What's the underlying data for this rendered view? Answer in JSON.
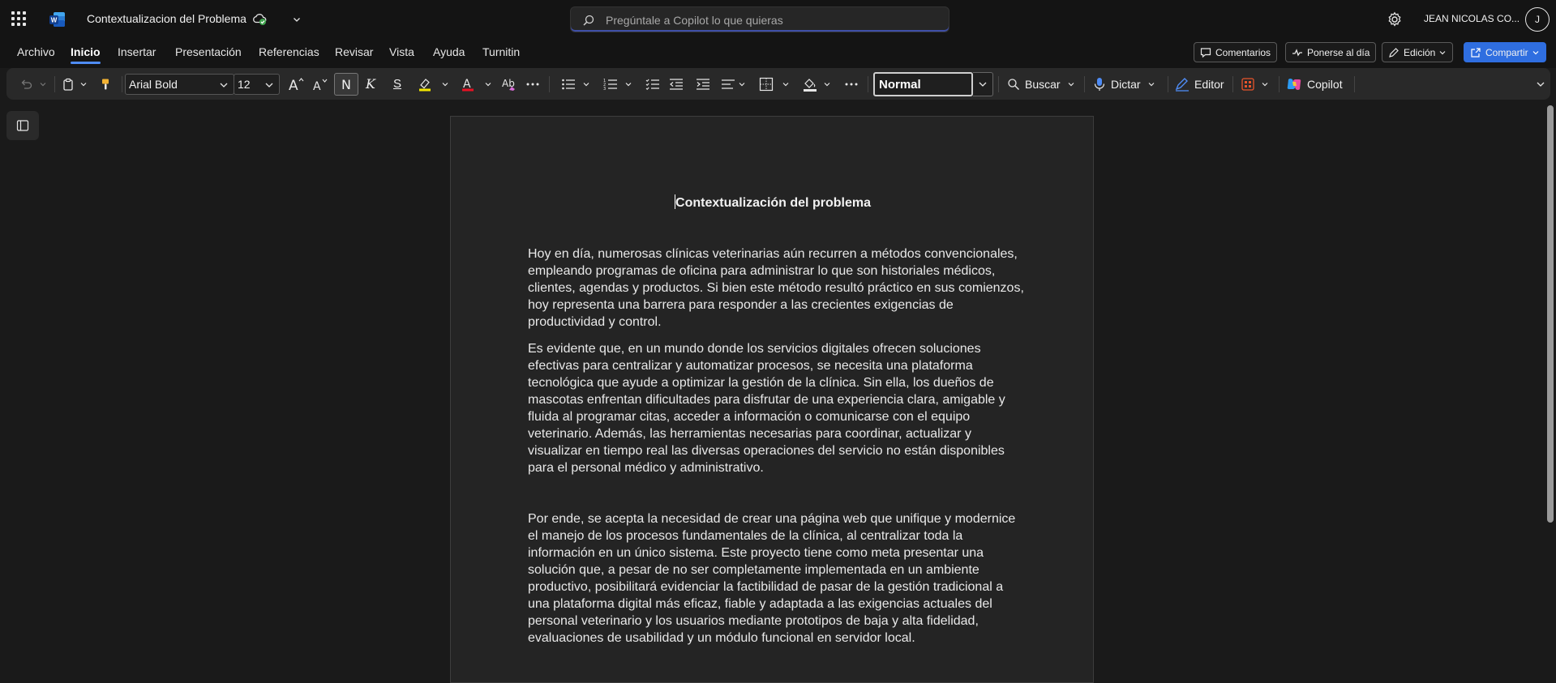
{
  "app": {
    "document_title": "Contextualizacion del Problema",
    "search_placeholder": "Pregúntale a Copilot lo que quieras",
    "user_name": "JEAN NICOLAS CO...",
    "avatar_initial": "J",
    "accent_color": "#2f6ee0",
    "word_blue": "#185abd"
  },
  "ribbon": {
    "tabs": [
      {
        "label": "Archivo",
        "active": false
      },
      {
        "label": "Inicio",
        "active": true
      },
      {
        "label": "Insertar",
        "active": false
      },
      {
        "label": "Presentación",
        "active": false
      },
      {
        "label": "Referencias",
        "active": false
      },
      {
        "label": "Revisar",
        "active": false
      },
      {
        "label": "Vista",
        "active": false
      },
      {
        "label": "Ayuda",
        "active": false
      },
      {
        "label": "Turnitin",
        "active": false
      }
    ],
    "buttons": {
      "comments": "Comentarios",
      "catch_up": "Ponerse al día",
      "editing": "Edición",
      "share": "Compartir"
    }
  },
  "toolbar": {
    "font_name": "Arial Bold",
    "font_size": "12",
    "bold_glyph": "N",
    "italic_glyph": "K",
    "underline_glyph": "S",
    "style_name": "Normal",
    "find_label": "Buscar",
    "dictate_label": "Dictar",
    "editor_label": "Editor",
    "copilot_label": "Copilot"
  },
  "document": {
    "heading": "Contextualización del problema",
    "paragraphs": [
      "Hoy en día, numerosas clínicas veterinarias aún recurren a métodos convencionales, empleando programas de oficina para administrar lo que son historiales médicos, clientes, agendas y productos. Si bien este método resultó práctico en sus comienzos, hoy representa una barrera para responder a las crecientes exigencias de productividad y control.",
      "Es evidente que, en un mundo donde los servicios digitales ofrecen soluciones efectivas para centralizar y automatizar procesos, se necesita una plataforma tecnológica que ayude a optimizar la gestión de la clínica. Sin ella, los dueños de mascotas enfrentan dificultades para disfrutar de una experiencia clara, amigable y fluida al programar citas, acceder a información o comunicarse con el equipo veterinario. Además, las herramientas necesarias para coordinar, actualizar y visualizar en tiempo real las diversas operaciones del servicio no están disponibles para el personal médico y administrativo.",
      "Por ende, se acepta la necesidad de crear una página web que unifique y modernice el manejo de los procesos fundamentales de la clínica, al centralizar toda la información en un único sistema. Este proyecto tiene como meta presentar una solución que, a pesar de no ser completamente implementada en un ambiente productivo, posibilitará evidenciar la factibilidad de pasar de la gestión tradicional a una plataforma digital más eficaz, fiable y adaptada a las exigencias actuales del personal veterinario y los usuarios mediante prototipos de baja y alta fidelidad, evaluaciones de usabilidad y un módulo funcional en servidor local."
    ]
  }
}
